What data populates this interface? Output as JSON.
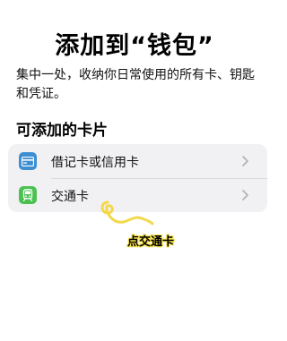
{
  "header": {
    "title": "添加到“钱包”",
    "subtitle": "集中一处，收纳你日常使用的所有卡、钥匙和凭证。"
  },
  "section": {
    "title": "可添加的卡片"
  },
  "cards": [
    {
      "label": "借记卡或信用卡",
      "icon": "credit-card-icon",
      "color": "#3d8fd1"
    },
    {
      "label": "交通卡",
      "icon": "train-icon",
      "color": "#4cc152"
    }
  ],
  "annotation": {
    "text": "点交通卡",
    "highlight_color": "#f5e04a"
  }
}
